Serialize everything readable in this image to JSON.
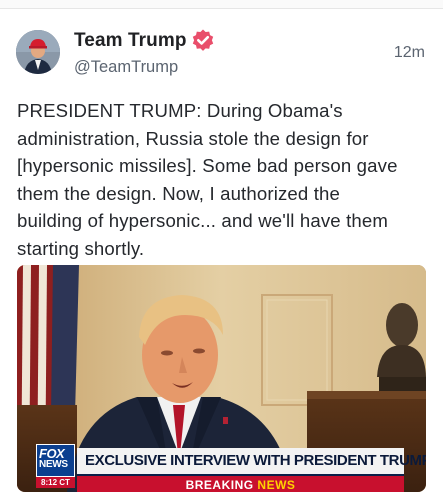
{
  "post": {
    "display_name": "Team Trump",
    "handle": "@TeamTrump",
    "timestamp": "12m",
    "text_lines": [
      "PRESIDENT TRUMP: During Obama's",
      "administration, Russia stole the design for",
      "[hypersonic missiles]. Some bad person gave",
      "them the design. Now, I authorized the",
      "building of hypersonic... and we'll have them",
      "starting shortly."
    ]
  },
  "media": {
    "fox_logo_line1": "FOX",
    "fox_logo_line2": "NEWS",
    "clock": "8:12 CT",
    "chyron": "EXCLUSIVE INTERVIEW WITH PRESIDENT TRUMP",
    "breaking_prefix": "BREAKING",
    "breaking_suffix": "NEWS"
  },
  "colors": {
    "verified_badge": "#e94e6b",
    "fox_blue": "#0b3f8f",
    "breaking_red": "#c8102e",
    "news_yellow": "#ffd200"
  },
  "icons": {
    "verified": "verified-badge-icon"
  }
}
